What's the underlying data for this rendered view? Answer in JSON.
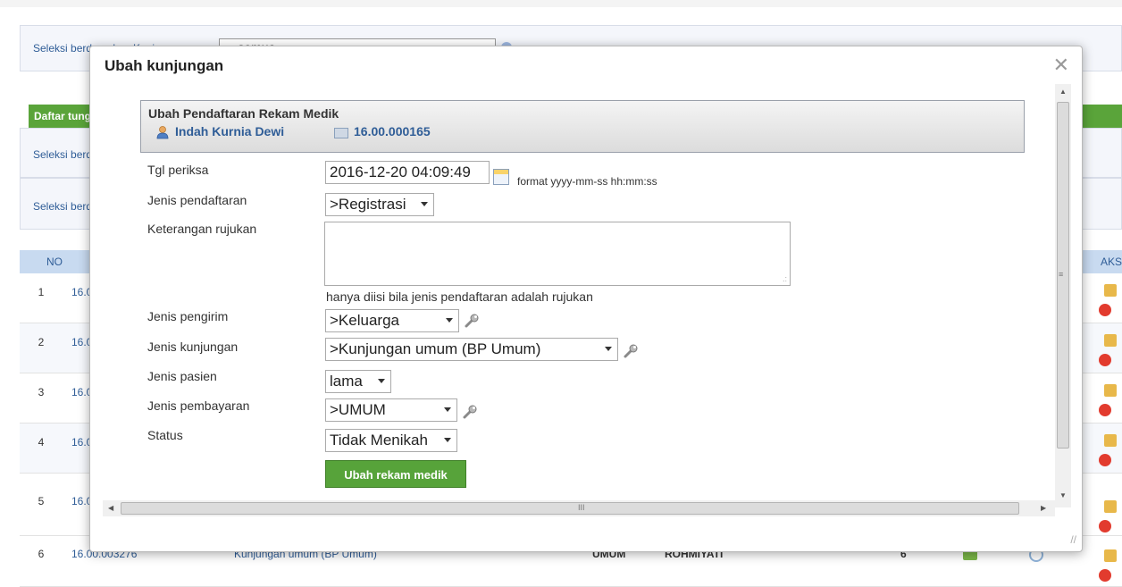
{
  "background": {
    "filter1_label": "Seleksi berdasarkan Kunjungan",
    "filter1_value": "==semua==",
    "green_bar_title": "Daftar tung",
    "filter2_label": "Seleksi berd",
    "filter3_label": "Seleksi berd",
    "table": {
      "col_no": "NO",
      "col_aksi": "AKSI",
      "rows": [
        {
          "no": "1",
          "id": "16.0"
        },
        {
          "no": "2",
          "id": "16.0"
        },
        {
          "no": "3",
          "id": "16.0"
        },
        {
          "no": "4",
          "id": "16.0"
        },
        {
          "no": "5",
          "id": "16.0"
        },
        {
          "no": "6",
          "id": "16.00.003276",
          "jenis_kunjungan": "Kunjungan umum (BP Umum)",
          "pembayaran": "UMUM",
          "nama": "ROHMIYATI",
          "count": "6"
        }
      ]
    }
  },
  "dialog": {
    "title": "Ubah kunjungan",
    "close_glyph": "✕",
    "header": {
      "title": "Ubah Pendaftaran Rekam Medik",
      "patient_name": "Indah Kurnia Dewi",
      "record_id": "16.00.000165"
    },
    "fields": {
      "tgl_periksa_label": "Tgl periksa",
      "tgl_periksa_value": "2016-12-20 04:09:49",
      "tgl_format_hint": "format yyyy-mm-ss hh:mm:ss",
      "jenis_pendaftaran_label": "Jenis pendaftaran",
      "jenis_pendaftaran_value": ">Registrasi",
      "keterangan_rujukan_label": "Keterangan rujukan",
      "keterangan_hint": "hanya diisi bila jenis pendaftaran adalah rujukan",
      "jenis_pengirim_label": "Jenis pengirim",
      "jenis_pengirim_value": ">Keluarga",
      "jenis_kunjungan_label": "Jenis kunjungan",
      "jenis_kunjungan_value": ">Kunjungan umum (BP Umum)",
      "jenis_pasien_label": "Jenis pasien",
      "jenis_pasien_value": "lama",
      "jenis_pembayaran_label": "Jenis pembayaran",
      "jenis_pembayaran_value": ">UMUM",
      "status_label": "Status",
      "status_value": "Tidak Menikah"
    },
    "submit_label": "Ubah rekam medik",
    "scroll": {
      "grip_v": "≡",
      "grip_h": "III",
      "up": "▲",
      "down": "▼",
      "left": "◀",
      "right": "▶",
      "resize": "//"
    }
  }
}
